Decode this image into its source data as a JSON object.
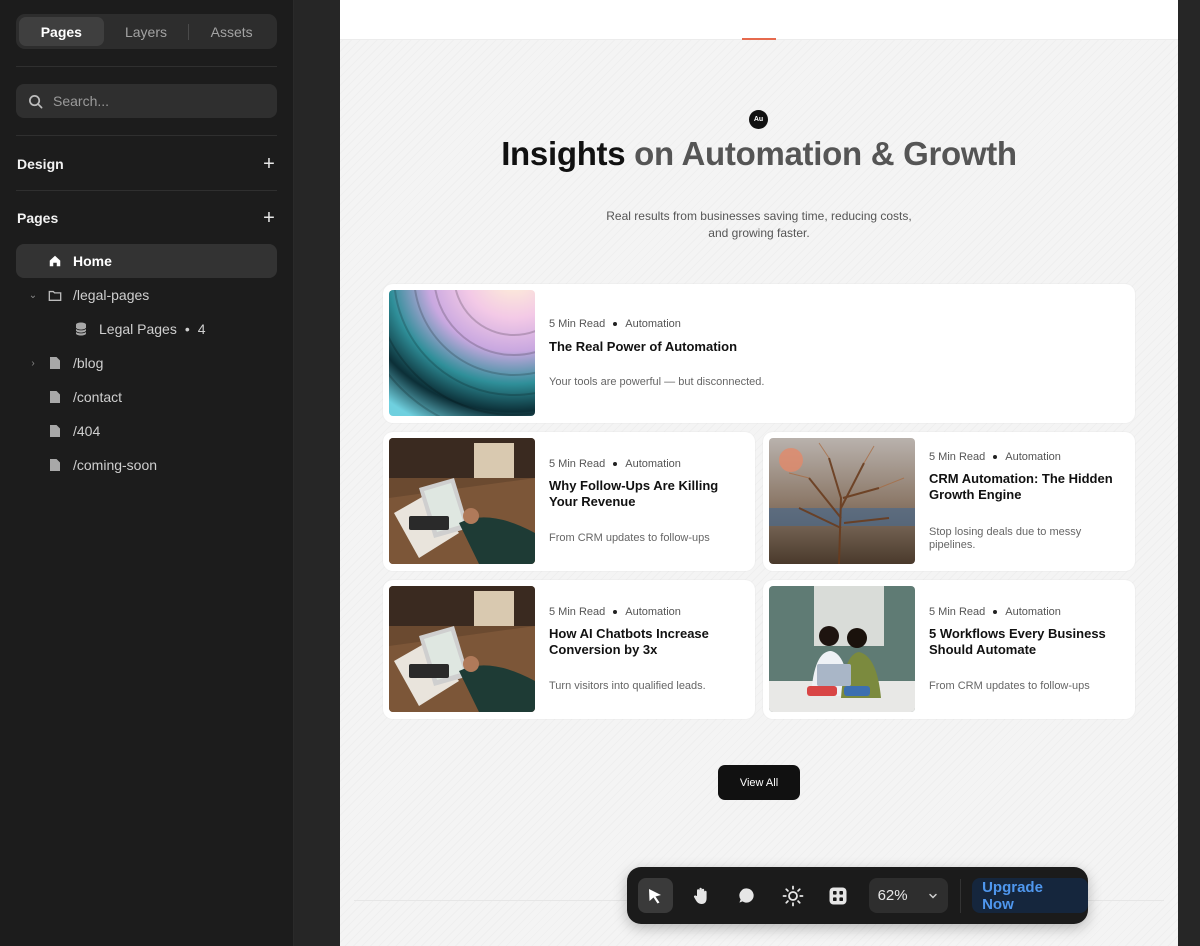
{
  "sidebar": {
    "tabs": [
      "Pages",
      "Layers",
      "Assets"
    ],
    "search_placeholder": "Search...",
    "design_label": "Design",
    "pages_label": "Pages",
    "pages": [
      {
        "label": "Home",
        "icon": "home-icon"
      },
      {
        "label": "/legal-pages",
        "icon": "folder-icon"
      },
      {
        "label": "Legal Pages",
        "count": "4",
        "icon": "database-icon"
      },
      {
        "label": "/blog",
        "icon": "page-icon"
      },
      {
        "label": "/contact",
        "icon": "page-icon"
      },
      {
        "label": "/404",
        "icon": "page-icon"
      },
      {
        "label": "/coming-soon",
        "icon": "page-icon"
      }
    ]
  },
  "canvas": {
    "logo_text": "Au",
    "headline_dark": "Insights",
    "headline_rest": " on Automation & Growth",
    "subhead": "Real results from businesses saving time, reducing costs, and growing faster.",
    "articles": [
      {
        "read": "5 Min Read",
        "tag": "Automation",
        "title": "The Real Power of Automation",
        "desc": "Your tools are powerful — but disconnected."
      },
      {
        "read": "5 Min Read",
        "tag": "Automation",
        "title": "Why Follow-Ups Are Killing Your Revenue",
        "desc": "From CRM updates to follow-ups"
      },
      {
        "read": "5 Min Read",
        "tag": "Automation",
        "title": "CRM Automation: The Hidden Growth Engine",
        "desc": "Stop losing deals due to messy pipelines."
      },
      {
        "read": "5 Min Read",
        "tag": "Automation",
        "title": "How AI Chatbots Increase Conversion by 3x",
        "desc": "Turn visitors into qualified leads."
      },
      {
        "read": "5 Min Read",
        "tag": "Automation",
        "title": "5 Workflows Every Business Should Automate",
        "desc": "From CRM updates to follow-ups"
      }
    ],
    "view_all": "View All"
  },
  "toolbar": {
    "tools": [
      "cursor-icon",
      "hand-icon",
      "comment-icon",
      "sun-icon",
      "component-icon"
    ],
    "zoom": "62%",
    "upgrade": "Upgrade Now"
  }
}
